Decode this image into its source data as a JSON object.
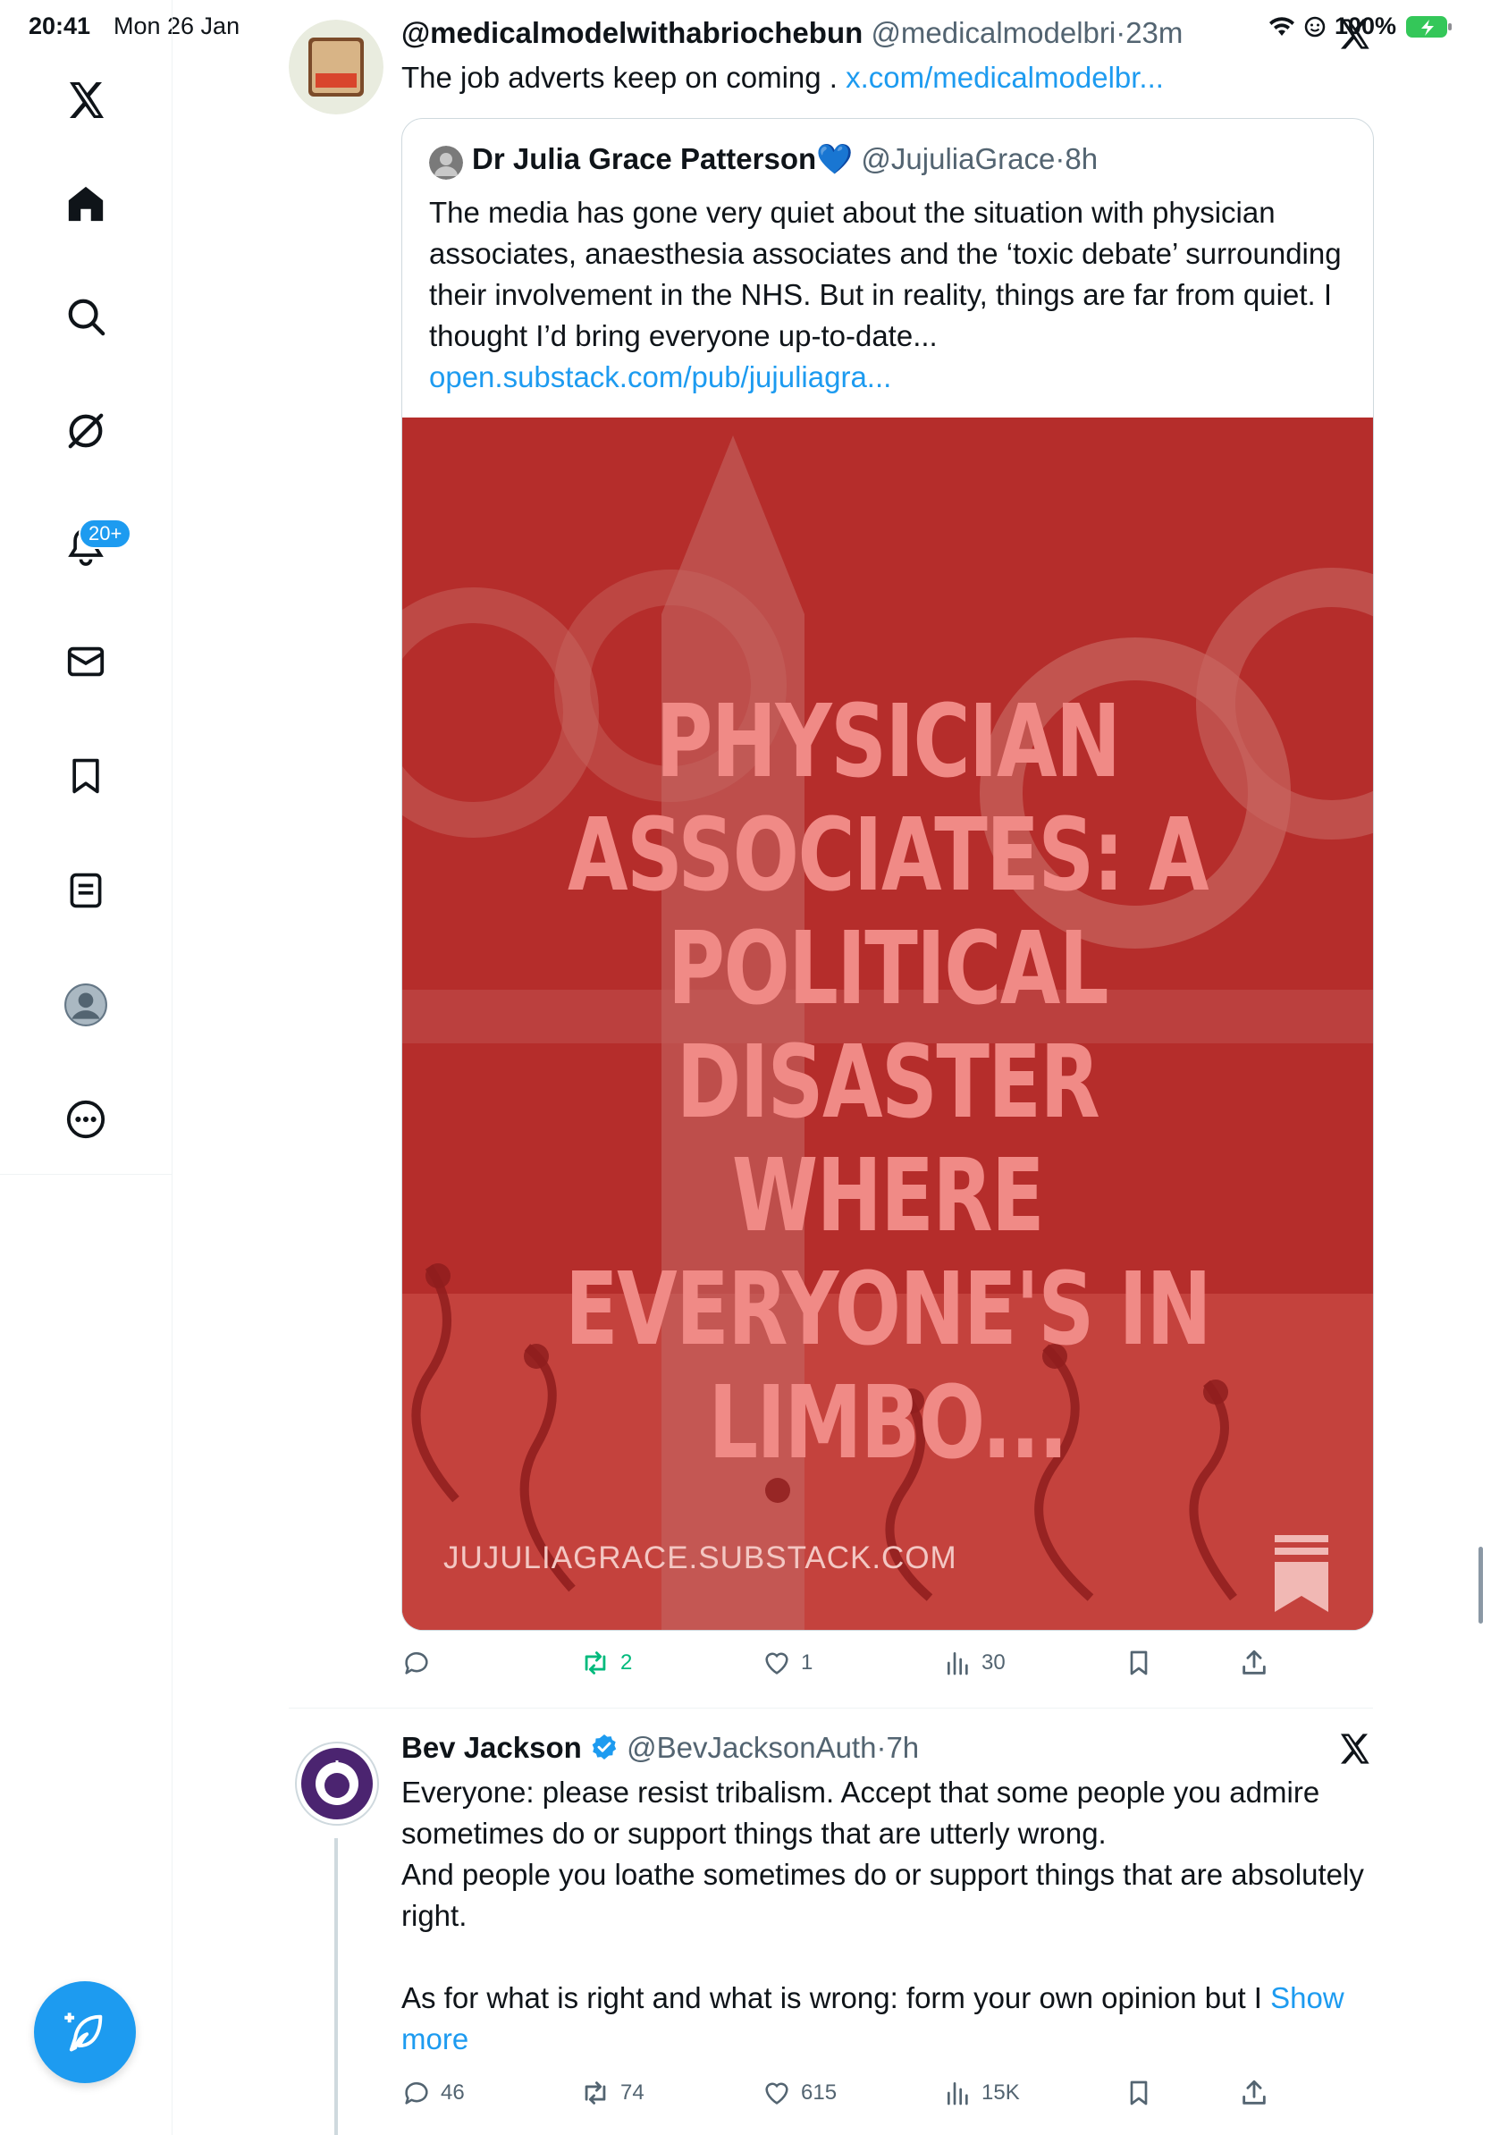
{
  "status_bar": {
    "time": "20:41",
    "date": "Mon 26 Jan",
    "battery": "100%"
  },
  "sidebar": {
    "notifications_badge": "20+"
  },
  "tweets": [
    {
      "display_name": "@medicalmodelwithabriochebun",
      "handle": "@medicalmodelbri",
      "time": "23m",
      "text": "The job adverts keep on coming .",
      "link": "x.com/medicalmodelbr...",
      "quote": {
        "display_name": "Dr Julia Grace Patterson",
        "handle": "@JujuliaGrace",
        "time": "8h",
        "text": "The media has gone very quiet about the situation with physician associates, anaesthesia associates and the ‘toxic debate’ surrounding their involvement in the NHS. But in reality, things are far from quiet. I thought I’d bring everyone up-to-date...",
        "link": "open.substack.com/pub/jujuliagra...",
        "image_headline": "PHYSICIAN ASSOCIATES: A POLITICAL DISASTER WHERE EVERYONE'S IN LIMBO...",
        "image_url": "JUJULIAGRACE.SUBSTACK.COM"
      },
      "stats": {
        "replies": "",
        "reposts": "2",
        "likes": "1",
        "views": "30"
      }
    },
    {
      "display_name": "Bev Jackson",
      "handle": "@BevJacksonAuth",
      "time": "7h",
      "text": "Everyone: please resist tribalism. Accept that some people you admire sometimes do or support things that are utterly wrong.\nAnd people you loathe sometimes do or support things that are absolutely right.\n\nAs for what is right and what is wrong: form your own opinion but I",
      "show_more": "Show more",
      "stats": {
        "replies": "46",
        "reposts": "74",
        "likes": "615",
        "views": "15K"
      }
    }
  ]
}
